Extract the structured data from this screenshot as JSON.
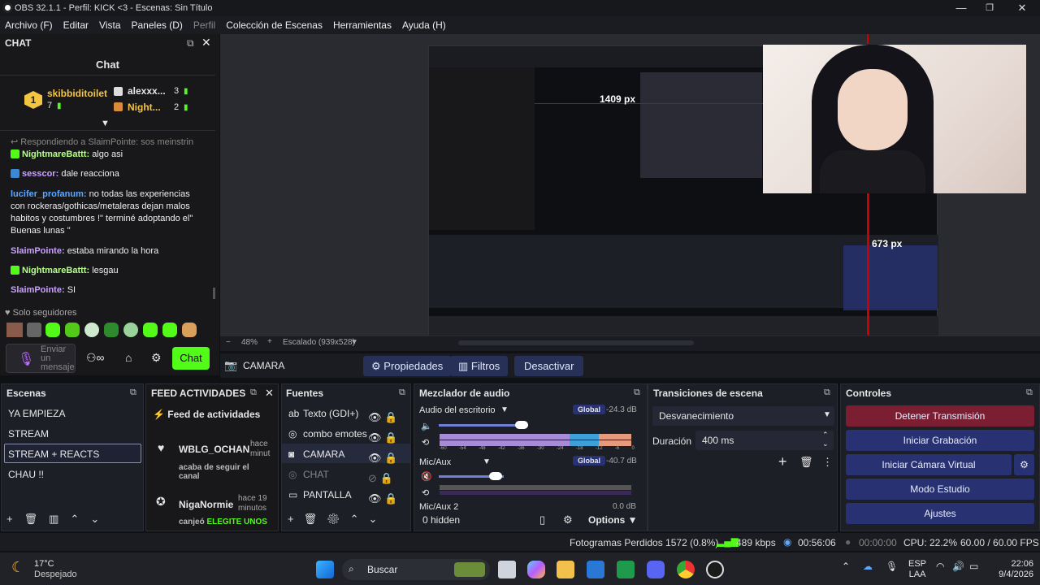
{
  "window": {
    "title": "OBS 32.1.1 - Perfil: KICK <3 - Escenas: Sin Título"
  },
  "menu": [
    "Archivo (F)",
    "Editar",
    "Vista",
    "Paneles (D)",
    "Perfil",
    "Colección de Escenas",
    "Herramientas",
    "Ayuda (H)"
  ],
  "chat": {
    "dock_title": "CHAT",
    "title": "Chat",
    "top_user": "skibbiditoilet",
    "top_count": "7",
    "rank2_user": "alexxx...",
    "rank2_count": "3",
    "rank3_user": "Night...",
    "rank3_count": "2",
    "replying": "Respondiendo a SlaimPointe: sos meinstrin",
    "messages": [
      {
        "user": "NightmareBattt:",
        "text": "algo asi"
      },
      {
        "user": "sesscor:",
        "text": "dale reacciona"
      },
      {
        "user": "lucifer_profanum:",
        "text": "no todas las experiencias con rockeras/gothicas/metaleras dejan malos habitos y costumbres !\" terminé adoptando el\" Buenas lunas \""
      },
      {
        "user": "SlaimPointe:",
        "text": "estaba mirando la hora"
      },
      {
        "user": "NightmareBattt:",
        "text": "lesgau"
      },
      {
        "user": "SlaimPointe:",
        "text": "SI"
      }
    ],
    "followers_only": "Solo seguidores",
    "input_placeholder": "Enviar un mensaje",
    "chat_button": "Chat"
  },
  "preview": {
    "zoom": "48%",
    "scale": "Escalado (939x528)",
    "overlay_px_1": "1409 px",
    "overlay_px_2": "673 px"
  },
  "source_bar": {
    "source": "CAMARA",
    "properties": "Propiedades",
    "filters": "Filtros",
    "deactivate": "Desactivar"
  },
  "scenes": {
    "title": "Escenas",
    "items": [
      "YA EMPIEZA",
      "STREAM",
      "STREAM + REACTS",
      "CHAU !!"
    ],
    "selected": 2
  },
  "feed": {
    "title": "FEED ACTIVIDADES",
    "header": "Feed de actividades",
    "events": [
      {
        "user": "WBLG_OCHAN",
        "time": "hace minut",
        "text": "acaba de seguir el canal"
      },
      {
        "user": "NigaNormie",
        "time": "hace 19 minutos",
        "text": "canjeó",
        "highlight": "ELEGITE UNOS"
      }
    ]
  },
  "sources": {
    "title": "Fuentes",
    "items": [
      "Texto (GDI+)",
      "combo emotes",
      "CAMARA",
      "CHAT",
      "PANTALLA"
    ]
  },
  "mixer": {
    "title": "Mezclador de audio",
    "channels": [
      {
        "name": "Audio del escritorio",
        "tag": "Global",
        "db": "-24.3 dB"
      },
      {
        "name": "Mic/Aux",
        "tag": "Global",
        "db": "-40.7 dB"
      },
      {
        "name": "Mic/Aux 2",
        "db": "0.0 dB"
      }
    ],
    "scale": [
      "-60",
      "-54",
      "-48",
      "-42",
      "-36",
      "-30",
      "-24",
      "-18",
      "-12",
      "-6",
      "0"
    ],
    "hidden": "0 hidden",
    "options": "Options"
  },
  "transitions": {
    "title": "Transiciones de escena",
    "selected": "Desvanecimiento",
    "duration_label": "Duración",
    "duration": "400 ms"
  },
  "controls": {
    "title": "Controles",
    "stop_stream": "Detener Transmisión",
    "start_rec": "Iniciar Grabación",
    "virtual_cam": "Iniciar Cámara Virtual",
    "studio": "Modo Estudio",
    "settings": "Ajustes"
  },
  "status": {
    "dropped": "Fotogramas Perdidos 1572 (0.8%)",
    "kbps": "489 kbps",
    "stream_time": "00:56:06",
    "rec_time": "00:00:00",
    "cpu": "CPU: 22.2%",
    "fps": "60.00 / 60.00 FPS"
  },
  "taskbar": {
    "temp": "17°C",
    "weather": "Despejado",
    "search": "Buscar",
    "lang1": "ESP",
    "lang2": "LAA",
    "time": "22:06",
    "date": "9/4/2026"
  },
  "colors": {
    "accent_green": "#53fc18",
    "stop_button": "#7b1e31",
    "control_button": "#283272"
  }
}
